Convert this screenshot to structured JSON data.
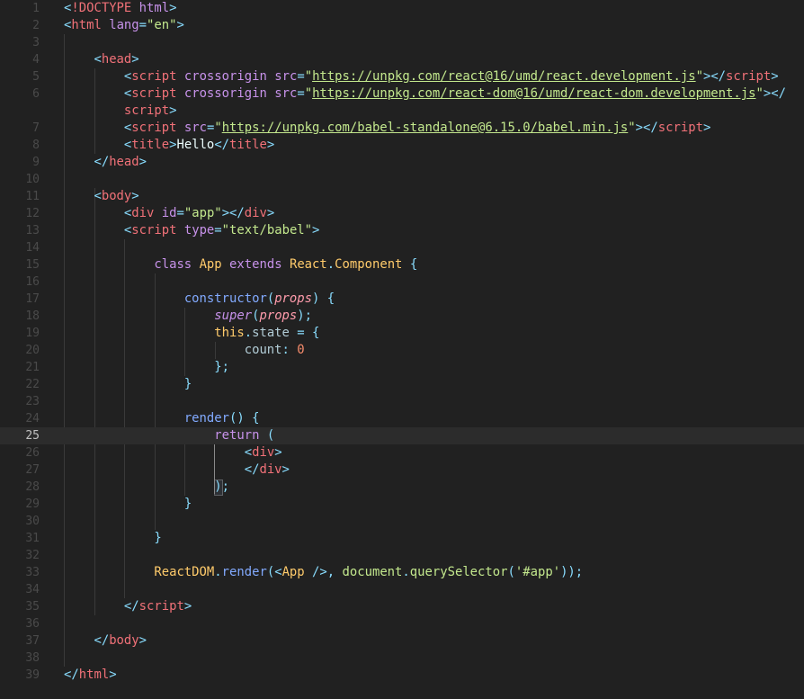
{
  "editor": {
    "theme_colors": {
      "background": "#212121",
      "line_number": "#4a4a4a",
      "active_line": "#2c2c2c",
      "tag": "#f07178",
      "attribute": "#c792ea",
      "string": "#c3e88d",
      "punctuation": "#89ddff",
      "keyword": "#c792ea",
      "class_name": "#ffcb6b",
      "function": "#82aaff",
      "number": "#f78c6c"
    },
    "active_line": 25,
    "lines": [
      {
        "n": "1",
        "tokens": [
          [
            "t-punct",
            "<"
          ],
          [
            "t-tag",
            "!DOCTYPE"
          ],
          [
            "t-var",
            " "
          ],
          [
            "t-attr",
            "html"
          ],
          [
            "t-punct",
            ">"
          ]
        ]
      },
      {
        "n": "2",
        "tokens": [
          [
            "t-punct",
            "<"
          ],
          [
            "t-tag",
            "html"
          ],
          [
            "t-var",
            " "
          ],
          [
            "t-attr",
            "lang"
          ],
          [
            "t-punct",
            "="
          ],
          [
            "t-str",
            "\"en\""
          ],
          [
            "t-punct",
            ">"
          ]
        ]
      },
      {
        "n": "3",
        "tokens": []
      },
      {
        "n": "4",
        "tokens": [
          [
            "t-var",
            "    "
          ],
          [
            "t-punct",
            "<"
          ],
          [
            "t-tag",
            "head"
          ],
          [
            "t-punct",
            ">"
          ]
        ]
      },
      {
        "n": "5",
        "tokens": [
          [
            "t-var",
            "        "
          ],
          [
            "t-punct",
            "<"
          ],
          [
            "t-tag",
            "script"
          ],
          [
            "t-var",
            " "
          ],
          [
            "t-attr",
            "crossorigin"
          ],
          [
            "t-var",
            " "
          ],
          [
            "t-attr",
            "src"
          ],
          [
            "t-punct",
            "="
          ],
          [
            "t-str",
            "\""
          ],
          [
            "t-str t-url",
            "https://unpkg.com/react@16/umd/react.development.js"
          ],
          [
            "t-str",
            "\""
          ],
          [
            "t-punct",
            "></"
          ],
          [
            "t-tag",
            "script"
          ],
          [
            "t-punct",
            ">"
          ]
        ]
      },
      {
        "n": "6",
        "tokens": [
          [
            "t-var",
            "        "
          ],
          [
            "t-punct",
            "<"
          ],
          [
            "t-tag",
            "script"
          ],
          [
            "t-var",
            " "
          ],
          [
            "t-attr",
            "crossorigin"
          ],
          [
            "t-var",
            " "
          ],
          [
            "t-attr",
            "src"
          ],
          [
            "t-punct",
            "="
          ],
          [
            "t-str",
            "\""
          ],
          [
            "t-str t-url",
            "https://unpkg.com/react-dom@16/umd/react-dom.development.js"
          ],
          [
            "t-str",
            "\""
          ],
          [
            "t-punct",
            "></"
          ]
        ]
      },
      {
        "n": "",
        "tokens": [
          [
            "t-var",
            "        "
          ],
          [
            "t-tag",
            "script"
          ],
          [
            "t-punct",
            ">"
          ]
        ]
      },
      {
        "n": "7",
        "tokens": [
          [
            "t-var",
            "        "
          ],
          [
            "t-punct",
            "<"
          ],
          [
            "t-tag",
            "script"
          ],
          [
            "t-var",
            " "
          ],
          [
            "t-attr",
            "src"
          ],
          [
            "t-punct",
            "="
          ],
          [
            "t-str",
            "\""
          ],
          [
            "t-str t-url",
            "https://unpkg.com/babel-standalone@6.15.0/babel.min.js"
          ],
          [
            "t-str",
            "\""
          ],
          [
            "t-punct",
            "></"
          ],
          [
            "t-tag",
            "script"
          ],
          [
            "t-punct",
            ">"
          ]
        ]
      },
      {
        "n": "8",
        "tokens": [
          [
            "t-var",
            "        "
          ],
          [
            "t-punct",
            "<"
          ],
          [
            "t-tag",
            "title"
          ],
          [
            "t-punct",
            ">"
          ],
          [
            "t-var",
            "Hello"
          ],
          [
            "t-punct",
            "</"
          ],
          [
            "t-tag",
            "title"
          ],
          [
            "t-punct",
            ">"
          ]
        ]
      },
      {
        "n": "9",
        "tokens": [
          [
            "t-var",
            "    "
          ],
          [
            "t-punct",
            "</"
          ],
          [
            "t-tag",
            "head"
          ],
          [
            "t-punct",
            ">"
          ]
        ]
      },
      {
        "n": "10",
        "tokens": []
      },
      {
        "n": "11",
        "tokens": [
          [
            "t-var",
            "    "
          ],
          [
            "t-punct",
            "<"
          ],
          [
            "t-tag",
            "body"
          ],
          [
            "t-punct",
            ">"
          ]
        ]
      },
      {
        "n": "12",
        "tokens": [
          [
            "t-var",
            "        "
          ],
          [
            "t-punct",
            "<"
          ],
          [
            "t-tag",
            "div"
          ],
          [
            "t-var",
            " "
          ],
          [
            "t-attr",
            "id"
          ],
          [
            "t-punct",
            "="
          ],
          [
            "t-str",
            "\"app\""
          ],
          [
            "t-punct",
            "></"
          ],
          [
            "t-tag",
            "div"
          ],
          [
            "t-punct",
            ">"
          ]
        ]
      },
      {
        "n": "13",
        "tokens": [
          [
            "t-var",
            "        "
          ],
          [
            "t-punct",
            "<"
          ],
          [
            "t-tag",
            "script"
          ],
          [
            "t-var",
            " "
          ],
          [
            "t-attr",
            "type"
          ],
          [
            "t-punct",
            "="
          ],
          [
            "t-str",
            "\"text/babel\""
          ],
          [
            "t-punct",
            ">"
          ]
        ]
      },
      {
        "n": "14",
        "tokens": []
      },
      {
        "n": "15",
        "tokens": [
          [
            "t-var",
            "            "
          ],
          [
            "t-kw",
            "class"
          ],
          [
            "t-var",
            " "
          ],
          [
            "t-cls",
            "App"
          ],
          [
            "t-var",
            " "
          ],
          [
            "t-kw",
            "extends"
          ],
          [
            "t-var",
            " "
          ],
          [
            "t-cls",
            "React"
          ],
          [
            "t-punct",
            "."
          ],
          [
            "t-cls",
            "Component"
          ],
          [
            "t-var",
            " "
          ],
          [
            "t-punct",
            "{"
          ]
        ]
      },
      {
        "n": "16",
        "tokens": []
      },
      {
        "n": "17",
        "tokens": [
          [
            "t-var",
            "                "
          ],
          [
            "t-fn",
            "constructor"
          ],
          [
            "t-punct",
            "("
          ],
          [
            "t-param",
            "props"
          ],
          [
            "t-punct",
            ")"
          ],
          [
            "t-var",
            " "
          ],
          [
            "t-punct",
            "{"
          ]
        ]
      },
      {
        "n": "18",
        "tokens": [
          [
            "t-var",
            "                    "
          ],
          [
            "t-italic-kw",
            "super"
          ],
          [
            "t-punct",
            "("
          ],
          [
            "t-param",
            "props"
          ],
          [
            "t-punct",
            ");"
          ]
        ]
      },
      {
        "n": "19",
        "tokens": [
          [
            "t-var",
            "                    "
          ],
          [
            "t-cls",
            "this"
          ],
          [
            "t-punct",
            "."
          ],
          [
            "t-prop",
            "state"
          ],
          [
            "t-var",
            " "
          ],
          [
            "t-punct",
            "="
          ],
          [
            "t-var",
            " "
          ],
          [
            "t-punct",
            "{"
          ]
        ]
      },
      {
        "n": "20",
        "tokens": [
          [
            "t-var",
            "                        "
          ],
          [
            "t-prop",
            "count"
          ],
          [
            "t-punct",
            ":"
          ],
          [
            "t-var",
            " "
          ],
          [
            "t-num",
            "0"
          ]
        ]
      },
      {
        "n": "21",
        "tokens": [
          [
            "t-var",
            "                    "
          ],
          [
            "t-punct",
            "};"
          ]
        ]
      },
      {
        "n": "22",
        "tokens": [
          [
            "t-var",
            "                "
          ],
          [
            "t-punct",
            "}"
          ]
        ]
      },
      {
        "n": "23",
        "tokens": []
      },
      {
        "n": "24",
        "tokens": [
          [
            "t-var",
            "                "
          ],
          [
            "t-fn",
            "render"
          ],
          [
            "t-punct",
            "()"
          ],
          [
            "t-var",
            " "
          ],
          [
            "t-punct",
            "{"
          ]
        ]
      },
      {
        "n": "25",
        "tokens": [
          [
            "t-var",
            "                    "
          ],
          [
            "t-kw",
            "return"
          ],
          [
            "t-var",
            " "
          ],
          [
            "t-punct",
            "("
          ]
        ]
      },
      {
        "n": "26",
        "tokens": [
          [
            "t-var",
            "                        "
          ],
          [
            "t-punct",
            "<"
          ],
          [
            "t-tag",
            "div"
          ],
          [
            "t-punct",
            ">"
          ]
        ]
      },
      {
        "n": "27",
        "tokens": [
          [
            "t-var",
            "                        "
          ],
          [
            "t-punct",
            "</"
          ],
          [
            "t-tag",
            "div"
          ],
          [
            "t-punct",
            ">"
          ]
        ]
      },
      {
        "n": "28",
        "tokens": [
          [
            "t-var",
            "                    "
          ],
          [
            "t-punct",
            ")"
          ],
          [
            "t-punct",
            ";"
          ]
        ]
      },
      {
        "n": "29",
        "tokens": [
          [
            "t-var",
            "                "
          ],
          [
            "t-punct",
            "}"
          ]
        ]
      },
      {
        "n": "30",
        "tokens": []
      },
      {
        "n": "31",
        "tokens": [
          [
            "t-var",
            "            "
          ],
          [
            "t-punct",
            "}"
          ]
        ]
      },
      {
        "n": "32",
        "tokens": []
      },
      {
        "n": "33",
        "tokens": [
          [
            "t-var",
            "            "
          ],
          [
            "t-cls",
            "ReactDOM"
          ],
          [
            "t-punct",
            "."
          ],
          [
            "t-fn",
            "render"
          ],
          [
            "t-punct",
            "(<"
          ],
          [
            "t-cls",
            "App"
          ],
          [
            "t-var",
            " "
          ],
          [
            "t-punct",
            "/>,"
          ],
          [
            "t-var",
            " "
          ],
          [
            "t-str",
            "document"
          ],
          [
            "t-punct",
            "."
          ],
          [
            "t-str",
            "querySelector"
          ],
          [
            "t-punct",
            "("
          ],
          [
            "t-str",
            "'#app'"
          ],
          [
            "t-punct",
            "));"
          ]
        ]
      },
      {
        "n": "34",
        "tokens": []
      },
      {
        "n": "35",
        "tokens": [
          [
            "t-var",
            "        "
          ],
          [
            "t-punct",
            "</"
          ],
          [
            "t-tag",
            "script"
          ],
          [
            "t-punct",
            ">"
          ]
        ]
      },
      {
        "n": "36",
        "tokens": []
      },
      {
        "n": "37",
        "tokens": [
          [
            "t-var",
            "    "
          ],
          [
            "t-punct",
            "</"
          ],
          [
            "t-tag",
            "body"
          ],
          [
            "t-punct",
            ">"
          ]
        ]
      },
      {
        "n": "38",
        "tokens": []
      },
      {
        "n": "39",
        "tokens": [
          [
            "t-punct",
            "</"
          ],
          [
            "t-tag",
            "html"
          ],
          [
            "t-punct",
            ">"
          ]
        ]
      }
    ]
  }
}
